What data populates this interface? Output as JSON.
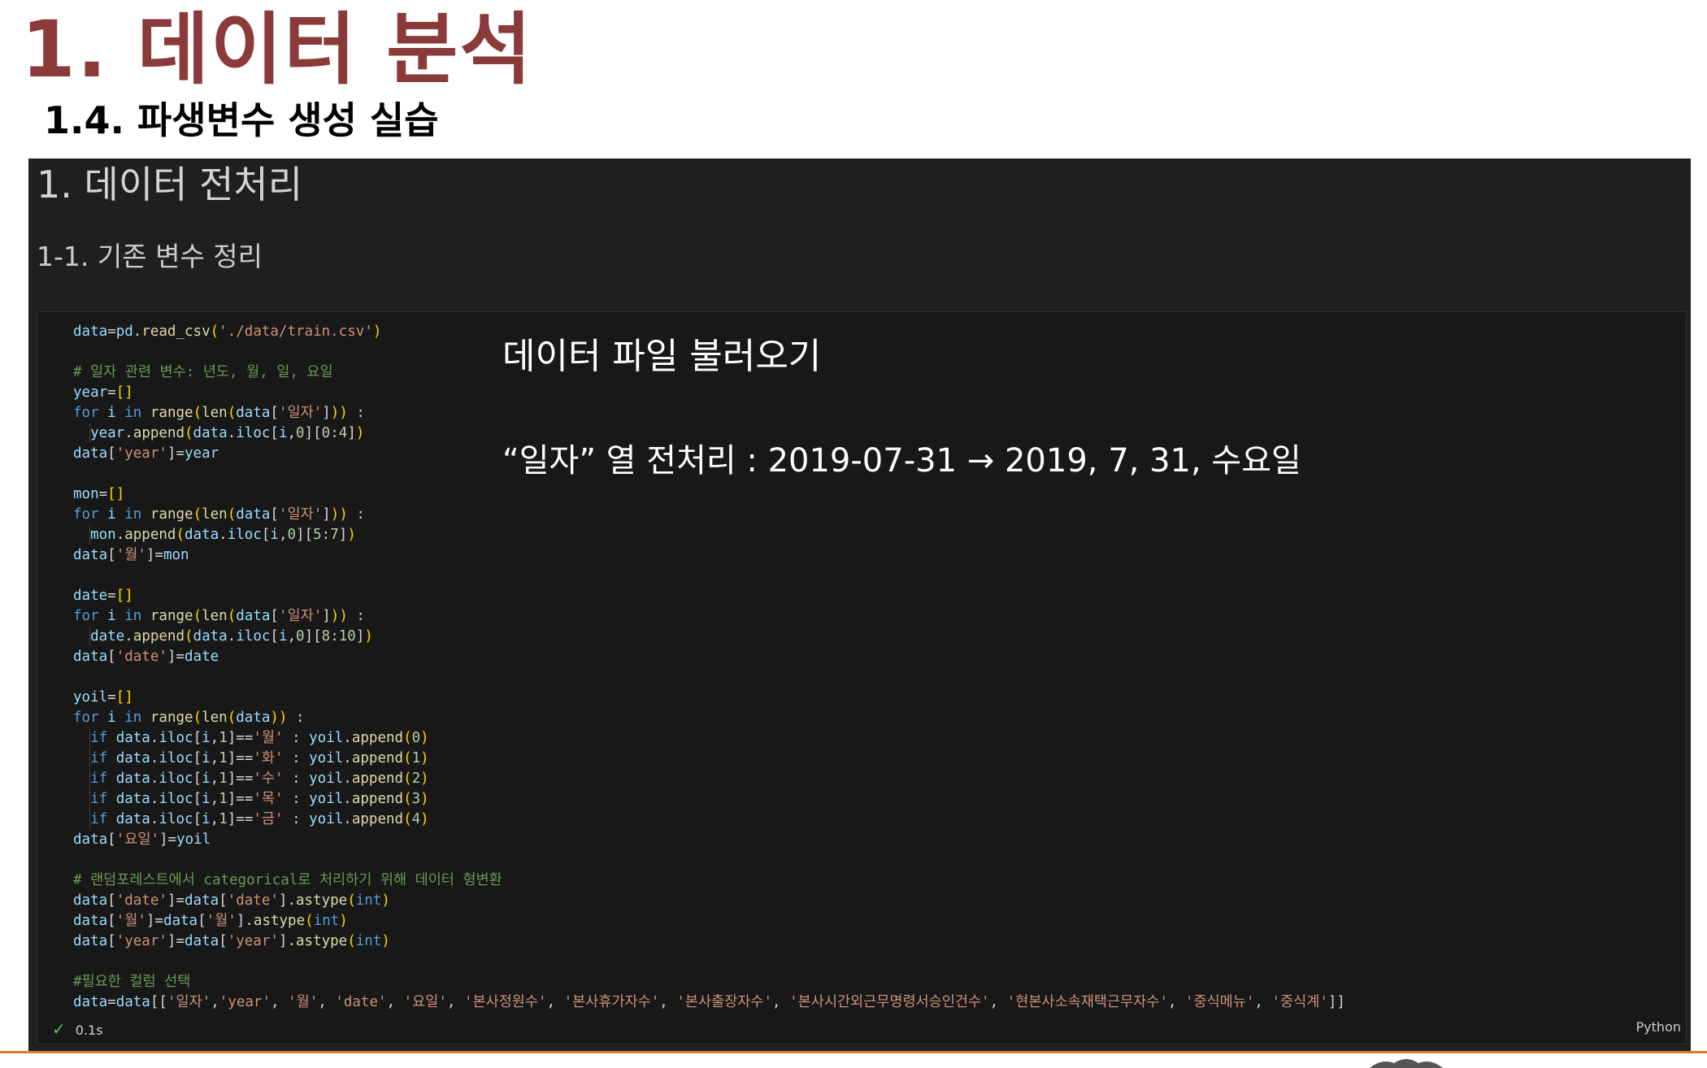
{
  "slide": {
    "title": "1. 데이터 분석",
    "subtitle": "1.4. 파생변수 생성 실습"
  },
  "notebook": {
    "markdown_h1": "1. 데이터 전처리",
    "markdown_h2": "1-1. 기존 변수 정리",
    "annotations": {
      "load_file": "데이터 파일 불러오기",
      "date_preprocess": "“일자” 열 전처리 : 2019-07-31 → 2019, 7, 31, 수요일"
    },
    "cell": {
      "status": "0.1s",
      "language": "Python"
    }
  }
}
